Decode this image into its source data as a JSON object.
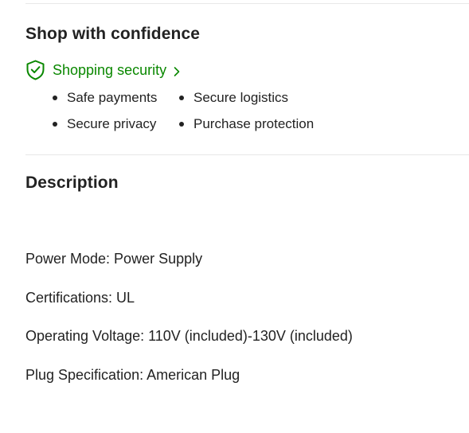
{
  "confidence": {
    "title": "Shop with confidence",
    "security_link": {
      "label": "Shopping security",
      "icon": "shield-check-icon",
      "chevron_icon": "chevron-right-icon",
      "color": "#0a8800"
    },
    "items": [
      "Safe payments",
      "Secure logistics",
      "Secure privacy",
      "Purchase protection"
    ]
  },
  "description": {
    "title": "Description",
    "specs": [
      "Power Mode: Power Supply",
      "Certifications: UL",
      "Operating Voltage: 110V (included)-130V (included)",
      "Plug Specification: American Plug"
    ]
  }
}
